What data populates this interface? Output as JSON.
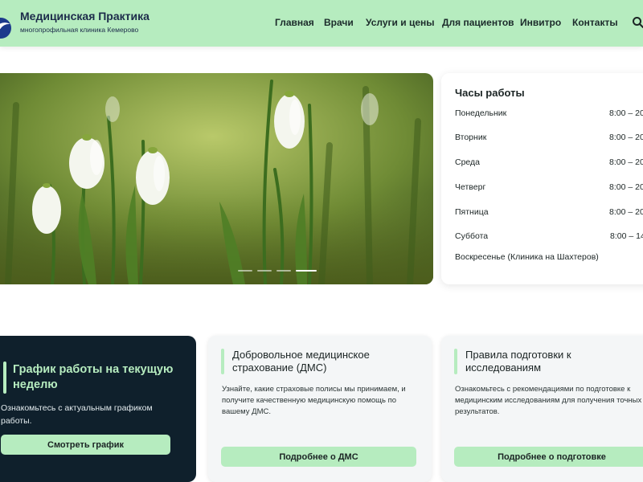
{
  "header": {
    "brand_name": "Медицинская Практика",
    "brand_sub": "многопрофильная клиника Кемерово",
    "nav": [
      "Главная",
      "Врачи",
      "Услуги и цены",
      "Для пациентов",
      "Инвитро",
      "Контакты"
    ],
    "search_icon": "search-icon"
  },
  "colors": {
    "accent": "#b6ecbf",
    "dark": "#0f202c",
    "brand": "#1c3a8c"
  },
  "hours": {
    "title": "Часы работы",
    "days": [
      {
        "day": "Понедельник",
        "time": "8:00 – 20"
      },
      {
        "day": "Вторник",
        "time": "8:00 – 20"
      },
      {
        "day": "Среда",
        "time": "8:00 – 20"
      },
      {
        "day": "Четверг",
        "time": "8:00 – 20"
      },
      {
        "day": "Пятница",
        "time": "8:00 – 20"
      },
      {
        "day": "Суббота",
        "time": "8:00 – 14"
      },
      {
        "day": "Воскресенье (Клиника на Шахтеров)",
        "time": ""
      }
    ]
  },
  "schedule_card": {
    "title": "График работы на текущую неделю",
    "text": "Ознакомьтесь с актуальным графиком работы.",
    "button": "Смотреть график"
  },
  "dms_card": {
    "title_line1": "Добровольное медицинское",
    "title_line2": "страхование (ДМС)",
    "text_line1": "Узнайте, какие страховые полисы мы принимаем, и",
    "text_line2": "получите качественную медицинскую помощь по",
    "text_line3": "вашему ДМС.",
    "button": "Подробнее о ДМС"
  },
  "prep_card": {
    "title_line1": "Правила подготовки к",
    "title_line2": "исследованиям",
    "text_line1": "Ознакомьтесь с рекомендациями по подготовке к",
    "text_line2": "медицинским исследованиям для получения точных",
    "text_line3": "результатов.",
    "button": "Подробнее о подготовке"
  }
}
